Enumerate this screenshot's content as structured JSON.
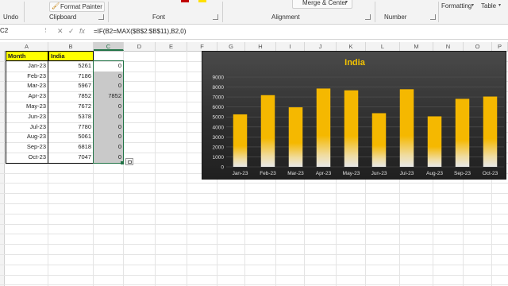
{
  "ribbon": {
    "undo_label": "Undo",
    "clipboard_label": "Clipboard",
    "format_painter_label": "Format Painter",
    "font_label": "Font",
    "alignment_label": "Alignment",
    "merge_center_label": "Merge & Center",
    "number_label": "Number",
    "formatting_label": "Formatting",
    "table_label": "Table"
  },
  "formula_bar": {
    "name_box": "C2",
    "fx": "fx",
    "formula": "=IF(B2=MAX($B$2:$B$11),B2,0)"
  },
  "columns": [
    "A",
    "B",
    "C",
    "D",
    "E",
    "F",
    "G",
    "H",
    "I",
    "J",
    "K",
    "L",
    "M",
    "N",
    "O",
    "P"
  ],
  "sheet": {
    "header": [
      "Month",
      "India",
      ""
    ],
    "rows": [
      {
        "month": "Jan-23",
        "india": "5261",
        "c": "0"
      },
      {
        "month": "Feb-23",
        "india": "7186",
        "c": "0"
      },
      {
        "month": "Mar-23",
        "india": "5967",
        "c": "0"
      },
      {
        "month": "Apr-23",
        "india": "7852",
        "c": "7852"
      },
      {
        "month": "May-23",
        "india": "7672",
        "c": "0"
      },
      {
        "month": "Jun-23",
        "india": "5378",
        "c": "0"
      },
      {
        "month": "Jul-23",
        "india": "7780",
        "c": "0"
      },
      {
        "month": "Aug-23",
        "india": "5061",
        "c": "0"
      },
      {
        "month": "Sep-23",
        "india": "6818",
        "c": "0"
      },
      {
        "month": "Oct-23",
        "india": "7047",
        "c": "0"
      }
    ]
  },
  "chart_data": {
    "type": "bar",
    "title": "India",
    "categories": [
      "Jan-23",
      "Feb-23",
      "Mar-23",
      "Apr-23",
      "May-23",
      "Jun-23",
      "Jul-23",
      "Aug-23",
      "Sep-23",
      "Oct-23"
    ],
    "values": [
      5261,
      7186,
      5967,
      7852,
      7672,
      5378,
      7780,
      5061,
      6818,
      7047
    ],
    "ylim": [
      0,
      9000
    ],
    "yticks": [
      "0",
      "1000",
      "2000",
      "3000",
      "4000",
      "5000",
      "6000",
      "7000",
      "8000",
      "9000"
    ],
    "grid": true,
    "colors": {
      "bar": "#f5b800",
      "bar_fade": "#e8e8e8",
      "title": "#f5c400",
      "label": "#e0e0e0"
    }
  },
  "colors": {
    "header_fill": "#ffff00",
    "selected_fill": "#c9c9c9",
    "active_border": "#217346"
  }
}
